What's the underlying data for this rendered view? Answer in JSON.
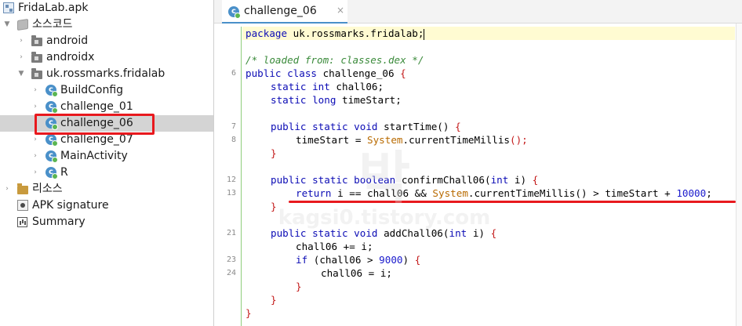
{
  "tree": {
    "root": "FridaLab.apk",
    "source_code": "소스코드",
    "pkg_android": "android",
    "pkg_androidx": "androidx",
    "pkg_app": "uk.rossmarks.fridalab",
    "classes": [
      "BuildConfig",
      "challenge_01",
      "challenge_06",
      "challenge_07",
      "MainActivity",
      "R"
    ],
    "resources": "리소스",
    "apk_signature": "APK signature",
    "summary": "Summary",
    "class_icon_glyph": "c"
  },
  "editor": {
    "tab_title": "challenge_06",
    "close_glyph": "×",
    "line_numbers": {
      "l6": "6",
      "l7": "7",
      "l8": "8",
      "l12": "12",
      "l13": "13",
      "l21": "21",
      "l23": "23",
      "l24": "24"
    },
    "code": {
      "pkg_kw": "package",
      "pkg_name": " uk.rossmarks.fridalab;",
      "comment": "/* loaded from: classes.dex */",
      "class_kw": "public class",
      "class_rest": " challenge_06 ",
      "f1_kw": "static int",
      "f1_rest": " chall06;",
      "f2_kw": "static long",
      "f2_rest": " timeStart;",
      "m1_kw": "public static void",
      "m1_rest": " startTime() ",
      "m1_body_a": "timeStart = ",
      "m1_sys": "System",
      "m1_body_b": ".currentTimeMillis",
      "m1_body_c": "();",
      "m2_kw": "public static boolean",
      "m2_rest_a": " confirmChall06(",
      "m2_int": "int",
      "m2_rest_b": " i) ",
      "ret_kw": "return",
      "ret_a": " i == chall06 && ",
      "ret_sys": "System",
      "ret_b": ".currentTimeMillis",
      "ret_c": "() > ",
      "ret_d": "timeStart + ",
      "ret_num": "10000",
      "ret_e": ";",
      "m3_kw": "public static void",
      "m3_rest_a": " addChall06(",
      "m3_int": "int",
      "m3_rest_b": " i) ",
      "add_line": "chall06 += i;",
      "if_kw": "if",
      "if_a": " (chall06 > ",
      "if_num": "9000",
      "if_b": ") ",
      "assign_line": "chall06 = i;",
      "open": "{",
      "close": "}"
    }
  },
  "watermark": {
    "glyph": "박",
    "domain": "kagsi0.tistory.com"
  },
  "colors": {
    "highlight_red": "#e8191e",
    "keyword_blue": "#0b0bb5",
    "system_orange": "#b86a00",
    "comment_green": "#3a8a3a",
    "selection_gray": "#d4d4d4"
  }
}
